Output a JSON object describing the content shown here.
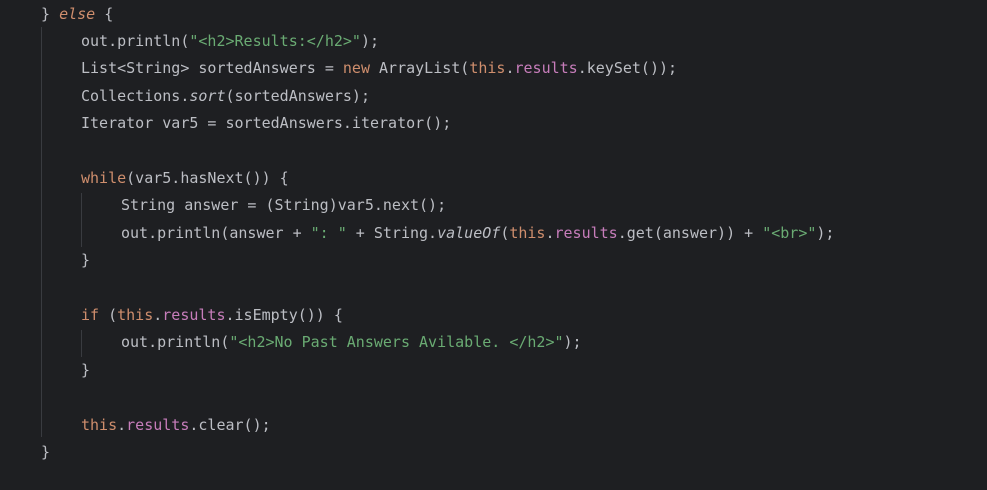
{
  "editor": {
    "lines": [
      {
        "indent": 0,
        "tokens": [
          {
            "t": "} ",
            "c": "plain"
          },
          {
            "t": "else",
            "c": "kw it"
          },
          {
            "t": " {",
            "c": "plain"
          }
        ]
      },
      {
        "indent": 1,
        "tokens": [
          {
            "t": "out.println(",
            "c": "plain"
          },
          {
            "t": "\"<h2>Results:</h2>\"",
            "c": "str"
          },
          {
            "t": ");",
            "c": "plain"
          }
        ]
      },
      {
        "indent": 1,
        "tokens": [
          {
            "t": "List<String> sortedAnswers = ",
            "c": "plain"
          },
          {
            "t": "new",
            "c": "kw"
          },
          {
            "t": " ArrayList(",
            "c": "plain"
          },
          {
            "t": "this",
            "c": "kw"
          },
          {
            "t": ".",
            "c": "plain"
          },
          {
            "t": "results",
            "c": "fld"
          },
          {
            "t": ".keySet());",
            "c": "plain"
          }
        ]
      },
      {
        "indent": 1,
        "tokens": [
          {
            "t": "Collections.",
            "c": "plain"
          },
          {
            "t": "sort",
            "c": "plain it"
          },
          {
            "t": "(sortedAnswers);",
            "c": "plain"
          }
        ]
      },
      {
        "indent": 1,
        "tokens": [
          {
            "t": "Iterator var5 = sortedAnswers.iterator();",
            "c": "plain"
          }
        ]
      },
      {
        "indent": 0,
        "tokens": []
      },
      {
        "indent": 1,
        "tokens": [
          {
            "t": "while",
            "c": "kw"
          },
          {
            "t": "(var5.hasNext()) {",
            "c": "plain"
          }
        ]
      },
      {
        "indent": 2,
        "tokens": [
          {
            "t": "String answer = (String)var5.next();",
            "c": "plain"
          }
        ]
      },
      {
        "indent": 2,
        "tokens": [
          {
            "t": "out.println(answer + ",
            "c": "plain"
          },
          {
            "t": "\": \"",
            "c": "str"
          },
          {
            "t": " + String.",
            "c": "plain"
          },
          {
            "t": "valueOf",
            "c": "plain it"
          },
          {
            "t": "(",
            "c": "plain"
          },
          {
            "t": "this",
            "c": "kw"
          },
          {
            "t": ".",
            "c": "plain"
          },
          {
            "t": "results",
            "c": "fld"
          },
          {
            "t": ".get(answer)) + ",
            "c": "plain"
          },
          {
            "t": "\"<br>\"",
            "c": "str"
          },
          {
            "t": ");",
            "c": "plain"
          }
        ]
      },
      {
        "indent": 1,
        "tokens": [
          {
            "t": "}",
            "c": "plain"
          }
        ]
      },
      {
        "indent": 0,
        "tokens": []
      },
      {
        "indent": 1,
        "tokens": [
          {
            "t": "if",
            "c": "kw"
          },
          {
            "t": " (",
            "c": "plain"
          },
          {
            "t": "this",
            "c": "kw"
          },
          {
            "t": ".",
            "c": "plain"
          },
          {
            "t": "results",
            "c": "fld"
          },
          {
            "t": ".isEmpty()) {",
            "c": "plain"
          }
        ]
      },
      {
        "indent": 2,
        "tokens": [
          {
            "t": "out.println(",
            "c": "plain"
          },
          {
            "t": "\"<h2>No Past Answers Avilable. </h2>\"",
            "c": "str"
          },
          {
            "t": ");",
            "c": "plain"
          }
        ]
      },
      {
        "indent": 1,
        "tokens": [
          {
            "t": "}",
            "c": "plain"
          }
        ]
      },
      {
        "indent": 0,
        "tokens": []
      },
      {
        "indent": 1,
        "tokens": [
          {
            "t": "this",
            "c": "kw"
          },
          {
            "t": ".",
            "c": "plain"
          },
          {
            "t": "results",
            "c": "fld"
          },
          {
            "t": ".clear();",
            "c": "plain"
          }
        ]
      },
      {
        "indent": 0,
        "tokens": [
          {
            "t": "}",
            "c": "plain"
          }
        ]
      }
    ],
    "colors": {
      "background": "#1e1f22",
      "text": "#bcbec4",
      "keyword": "#cf8e6d",
      "string": "#6aab73",
      "field": "#c77dbb",
      "indent_guide": "#393b40"
    }
  }
}
